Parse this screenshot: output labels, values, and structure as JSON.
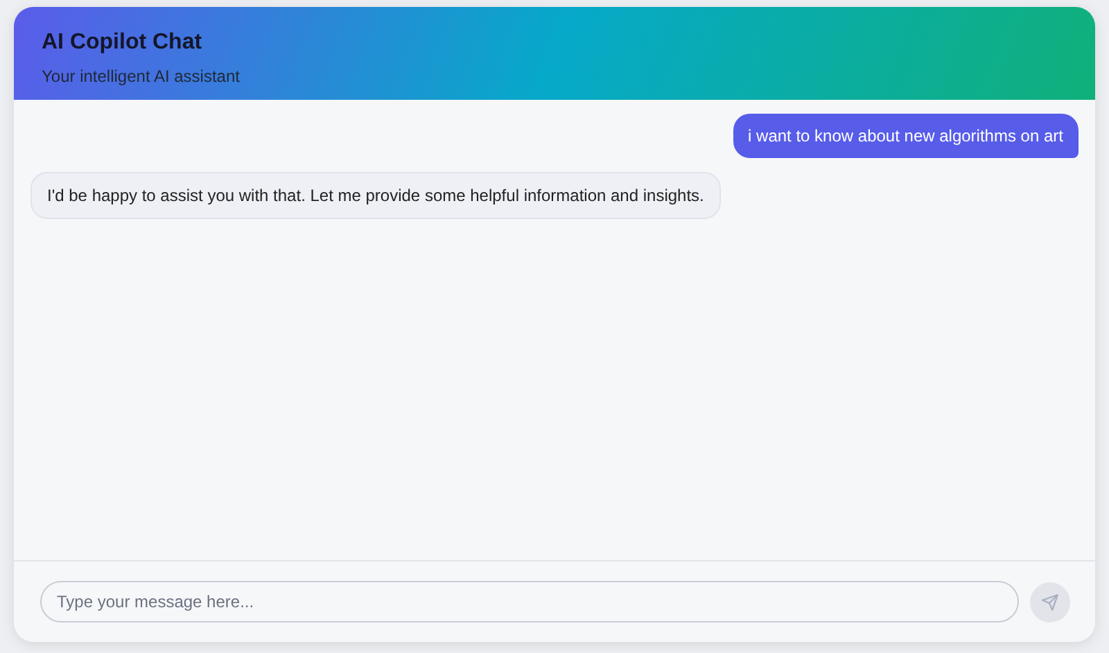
{
  "header": {
    "title": "AI Copilot Chat",
    "subtitle": "Your intelligent AI assistant"
  },
  "messages": [
    {
      "kind": "user",
      "text": "i want to know about new algorithms on art"
    },
    {
      "kind": "assistant",
      "text": "I'd be happy to assist you with that. Let me provide some helpful information and insights."
    }
  ],
  "composer": {
    "placeholder": "Type your message here...",
    "send_disabled": true
  }
}
